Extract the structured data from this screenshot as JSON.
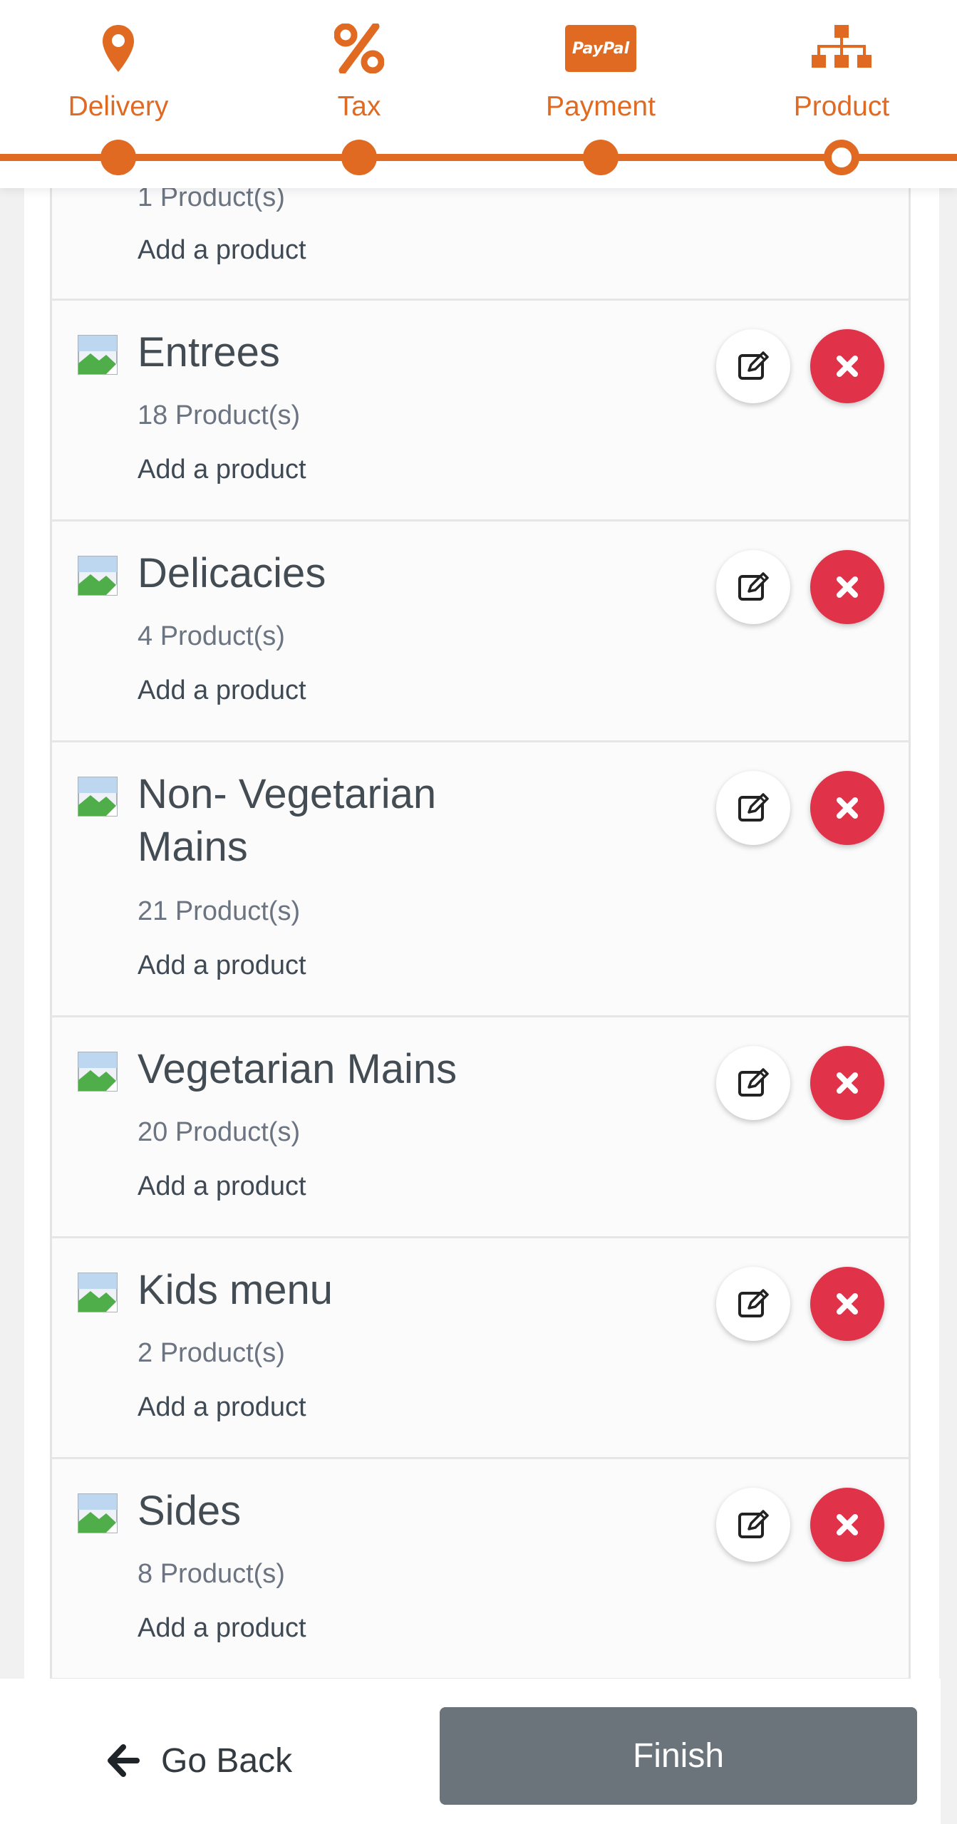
{
  "stepper": {
    "accent_color": "#e06a22",
    "steps": [
      {
        "label": "Delivery",
        "icon": "map-pin-icon",
        "status": "done"
      },
      {
        "label": "Tax",
        "icon": "percent-icon",
        "status": "done"
      },
      {
        "label": "Payment",
        "icon": "paypal-icon",
        "icon_text": "PayPal",
        "status": "done"
      },
      {
        "label": "Product",
        "icon": "sitemap-icon",
        "status": "current"
      }
    ]
  },
  "categories": {
    "add_label": "Add a product",
    "items": [
      {
        "title": "",
        "count": "1 Product(s)",
        "partial": true
      },
      {
        "title": "Entrees",
        "count": "18 Product(s)"
      },
      {
        "title": "Delicacies",
        "count": "4 Product(s)"
      },
      {
        "title": "Non- Vegetarian Mains",
        "count": "21 Product(s)"
      },
      {
        "title": "Vegetarian Mains",
        "count": "20 Product(s)"
      },
      {
        "title": "Kids menu",
        "count": "2 Product(s)"
      },
      {
        "title": "Sides",
        "count": "8 Product(s)"
      }
    ],
    "delete_color": "#e0334a"
  },
  "footer": {
    "back_label": "Go Back",
    "finish_label": "Finish",
    "finish_color": "#6c747b"
  }
}
